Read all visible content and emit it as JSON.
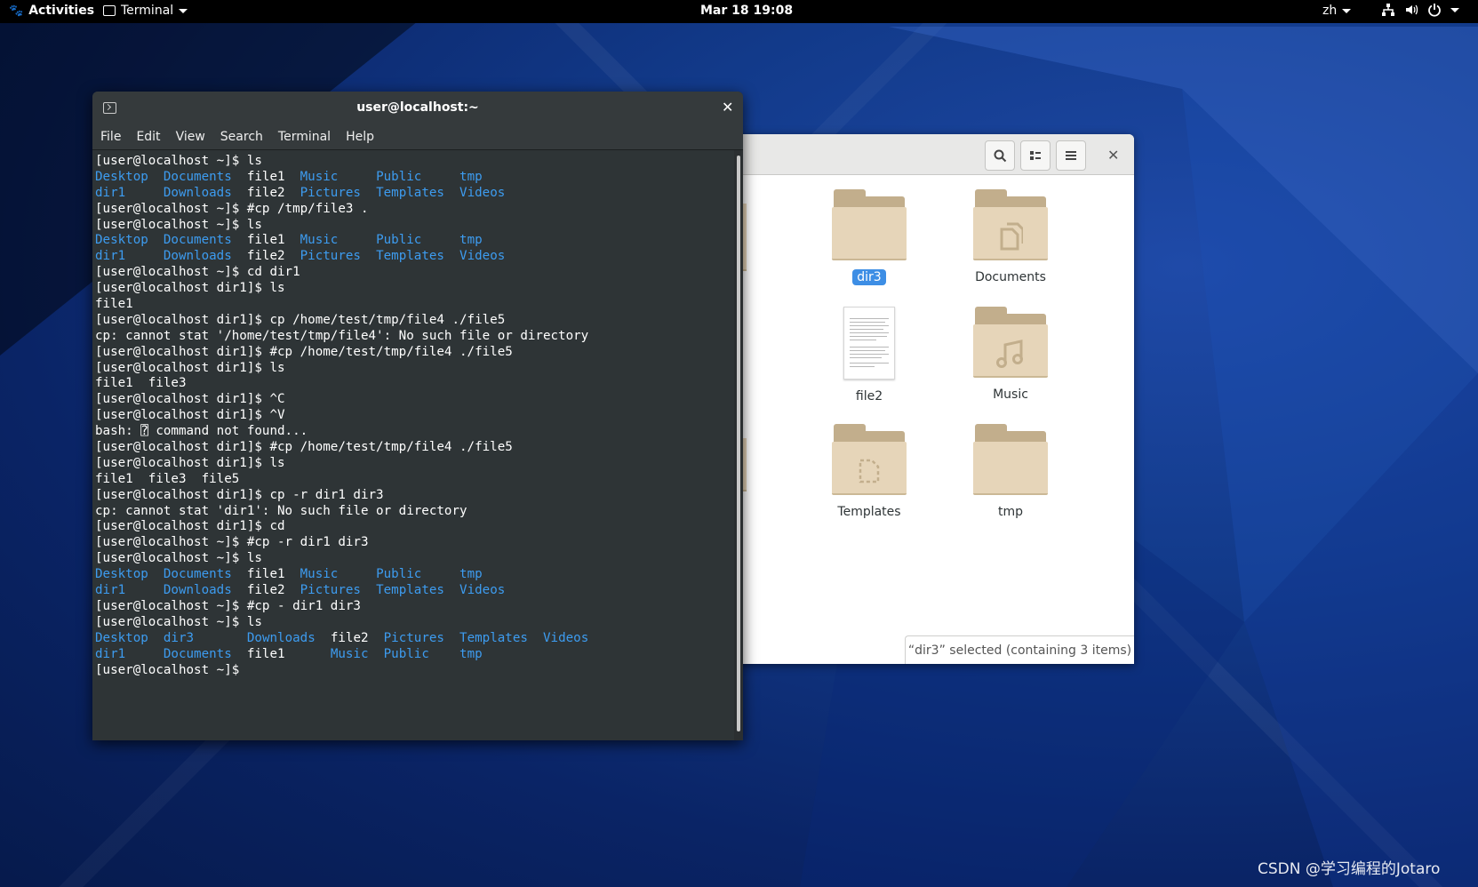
{
  "topbar": {
    "activities": "Activities",
    "app_menu": "Terminal",
    "clock": "Mar 18  19:08",
    "lang": "zh"
  },
  "terminal": {
    "title": "user@localhost:~",
    "menu": [
      "File",
      "Edit",
      "View",
      "Search",
      "Terminal",
      "Help"
    ],
    "lines": [
      [
        [
          "[user@localhost ~]$ ls",
          "t"
        ]
      ],
      [
        [
          "Desktop",
          "d"
        ],
        [
          "  ",
          "t"
        ],
        [
          "Documents",
          "d"
        ],
        [
          "  file1  ",
          "t"
        ],
        [
          "Music",
          "d"
        ],
        [
          "     ",
          "t"
        ],
        [
          "Public",
          "d"
        ],
        [
          "     ",
          "t"
        ],
        [
          "tmp",
          "d"
        ]
      ],
      [
        [
          "dir1",
          "d"
        ],
        [
          "     ",
          "t"
        ],
        [
          "Downloads",
          "d"
        ],
        [
          "  file2  ",
          "t"
        ],
        [
          "Pictures",
          "d"
        ],
        [
          "  ",
          "t"
        ],
        [
          "Templates",
          "d"
        ],
        [
          "  ",
          "t"
        ],
        [
          "Videos",
          "d"
        ]
      ],
      [
        [
          "[user@localhost ~]$ #cp /tmp/file3 .",
          "t"
        ]
      ],
      [
        [
          "[user@localhost ~]$ ls",
          "t"
        ]
      ],
      [
        [
          "Desktop",
          "d"
        ],
        [
          "  ",
          "t"
        ],
        [
          "Documents",
          "d"
        ],
        [
          "  file1  ",
          "t"
        ],
        [
          "Music",
          "d"
        ],
        [
          "     ",
          "t"
        ],
        [
          "Public",
          "d"
        ],
        [
          "     ",
          "t"
        ],
        [
          "tmp",
          "d"
        ]
      ],
      [
        [
          "dir1",
          "d"
        ],
        [
          "     ",
          "t"
        ],
        [
          "Downloads",
          "d"
        ],
        [
          "  file2  ",
          "t"
        ],
        [
          "Pictures",
          "d"
        ],
        [
          "  ",
          "t"
        ],
        [
          "Templates",
          "d"
        ],
        [
          "  ",
          "t"
        ],
        [
          "Videos",
          "d"
        ]
      ],
      [
        [
          "[user@localhost ~]$ cd dir1",
          "t"
        ]
      ],
      [
        [
          "[user@localhost dir1]$ ls",
          "t"
        ]
      ],
      [
        [
          "file1",
          "t"
        ]
      ],
      [
        [
          "[user@localhost dir1]$ cp /home/test/tmp/file4 ./file5",
          "t"
        ]
      ],
      [
        [
          "cp: cannot stat '/home/test/tmp/file4': No such file or directory",
          "t"
        ]
      ],
      [
        [
          "[user@localhost dir1]$ #cp /home/test/tmp/file4 ./file5",
          "t"
        ]
      ],
      [
        [
          "[user@localhost dir1]$ ls",
          "t"
        ]
      ],
      [
        [
          "file1  file3",
          "t"
        ]
      ],
      [
        [
          "[user@localhost dir1]$ ^C",
          "t"
        ]
      ],
      [
        [
          "[user@localhost dir1]$ ^V",
          "t"
        ]
      ],
      [
        [
          "bash: ",
          "t"
        ],
        [
          "⍰",
          "t"
        ],
        [
          " command not found...",
          "t"
        ]
      ],
      [
        [
          "[user@localhost dir1]$ #cp /home/test/tmp/file4 ./file5",
          "t"
        ]
      ],
      [
        [
          "[user@localhost dir1]$ ls",
          "t"
        ]
      ],
      [
        [
          "file1  file3  file5",
          "t"
        ]
      ],
      [
        [
          "[user@localhost dir1]$ cp -r dir1 dir3",
          "t"
        ]
      ],
      [
        [
          "cp: cannot stat 'dir1': No such file or directory",
          "t"
        ]
      ],
      [
        [
          "[user@localhost dir1]$ cd",
          "t"
        ]
      ],
      [
        [
          "[user@localhost ~]$ #cp -r dir1 dir3",
          "t"
        ]
      ],
      [
        [
          "[user@localhost ~]$ ls",
          "t"
        ]
      ],
      [
        [
          "Desktop",
          "d"
        ],
        [
          "  ",
          "t"
        ],
        [
          "Documents",
          "d"
        ],
        [
          "  file1  ",
          "t"
        ],
        [
          "Music",
          "d"
        ],
        [
          "     ",
          "t"
        ],
        [
          "Public",
          "d"
        ],
        [
          "     ",
          "t"
        ],
        [
          "tmp",
          "d"
        ]
      ],
      [
        [
          "dir1",
          "d"
        ],
        [
          "     ",
          "t"
        ],
        [
          "Downloads",
          "d"
        ],
        [
          "  file2  ",
          "t"
        ],
        [
          "Pictures",
          "d"
        ],
        [
          "  ",
          "t"
        ],
        [
          "Templates",
          "d"
        ],
        [
          "  ",
          "t"
        ],
        [
          "Videos",
          "d"
        ]
      ],
      [
        [
          "[user@localhost ~]$ #cp - dir1 dir3",
          "t"
        ]
      ],
      [
        [
          "[user@localhost ~]$ ls",
          "t"
        ]
      ],
      [
        [
          "Desktop",
          "d"
        ],
        [
          "  ",
          "t"
        ],
        [
          "dir3",
          "d"
        ],
        [
          "       ",
          "t"
        ],
        [
          "Downloads",
          "d"
        ],
        [
          "  file2  ",
          "t"
        ],
        [
          "Pictures",
          "d"
        ],
        [
          "  ",
          "t"
        ],
        [
          "Templates",
          "d"
        ],
        [
          "  ",
          "t"
        ],
        [
          "Videos",
          "d"
        ]
      ],
      [
        [
          "dir1",
          "d"
        ],
        [
          "     ",
          "t"
        ],
        [
          "Documents",
          "d"
        ],
        [
          "  file1      ",
          "t"
        ],
        [
          "Music",
          "d"
        ],
        [
          "  ",
          "t"
        ],
        [
          "Public",
          "d"
        ],
        [
          "    ",
          "t"
        ],
        [
          "tmp",
          "d"
        ]
      ],
      [
        [
          "[user@localhost ~]$ ",
          "t"
        ]
      ]
    ]
  },
  "files": {
    "items": [
      {
        "label": "dir3",
        "kind": "folder",
        "emblem": "",
        "selected": true
      },
      {
        "label": "Documents",
        "kind": "folder",
        "emblem": "documents-icon",
        "selected": false
      },
      {
        "label": "file2",
        "kind": "document",
        "emblem": "",
        "selected": false
      },
      {
        "label": "Music",
        "kind": "folder",
        "emblem": "music-icon",
        "selected": false
      },
      {
        "label": "Templates",
        "kind": "folder",
        "emblem": "templates-icon",
        "selected": false
      },
      {
        "label": "tmp",
        "kind": "folder",
        "emblem": "",
        "selected": false
      }
    ],
    "status": "“dir3” selected  (containing 3 items)"
  },
  "watermark": "CSDN @学习编程的Jotaro",
  "colors": {
    "terminal_bg": "#2e3436",
    "dir_blue": "#3d9cf0",
    "selection": "#3d8ee5",
    "folder": "#e6d5b9"
  }
}
